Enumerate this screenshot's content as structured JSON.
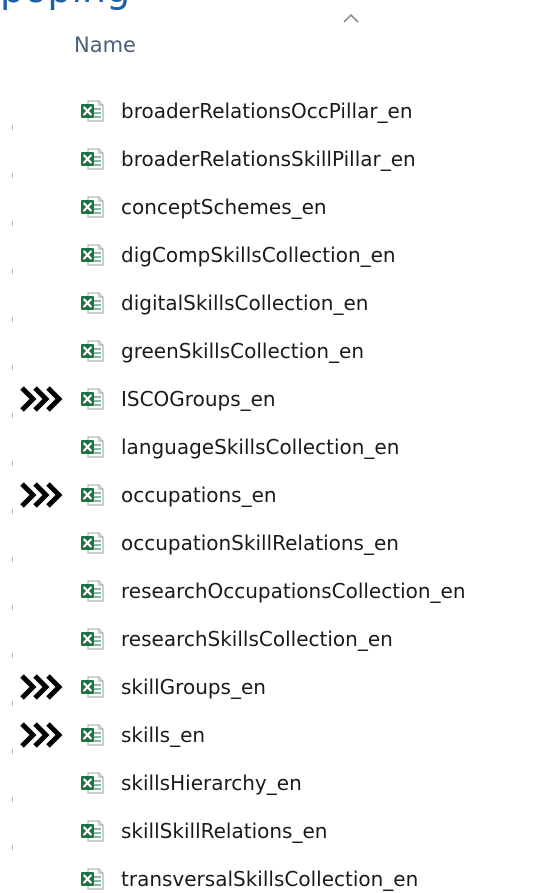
{
  "header": {
    "title_partial": "p",
    "title_fragment": "oping",
    "column_name": "Name",
    "sort_indicator": "ascending"
  },
  "files": [
    {
      "name": "broaderRelationsOccPillar_en",
      "icon": "excel-icon",
      "marked": false
    },
    {
      "name": "broaderRelationsSkillPillar_en",
      "icon": "excel-icon",
      "marked": false
    },
    {
      "name": "conceptSchemes_en",
      "icon": "excel-icon",
      "marked": false
    },
    {
      "name": "digCompSkillsCollection_en",
      "icon": "excel-icon",
      "marked": false
    },
    {
      "name": "digitalSkillsCollection_en",
      "icon": "excel-icon",
      "marked": false
    },
    {
      "name": "greenSkillsCollection_en",
      "icon": "excel-icon",
      "marked": false
    },
    {
      "name": "ISCOGroups_en",
      "icon": "excel-icon",
      "marked": true
    },
    {
      "name": "languageSkillsCollection_en",
      "icon": "excel-icon",
      "marked": false
    },
    {
      "name": "occupations_en",
      "icon": "excel-icon",
      "marked": true
    },
    {
      "name": "occupationSkillRelations_en",
      "icon": "excel-icon",
      "marked": false
    },
    {
      "name": "researchOccupationsCollection_en",
      "icon": "excel-icon",
      "marked": false
    },
    {
      "name": "researchSkillsCollection_en",
      "icon": "excel-icon",
      "marked": false
    },
    {
      "name": "skillGroups_en",
      "icon": "excel-icon",
      "marked": true
    },
    {
      "name": "skills_en",
      "icon": "excel-icon",
      "marked": true
    },
    {
      "name": "skillsHierarchy_en",
      "icon": "excel-icon",
      "marked": false
    },
    {
      "name": "skillSkillRelations_en",
      "icon": "excel-icon",
      "marked": false
    },
    {
      "name": "transversalSkillsCollection_en",
      "icon": "excel-icon",
      "marked": false
    }
  ],
  "colors": {
    "title": "#1f5fa8",
    "header_text": "#4c607a",
    "excel_green": "#1e7145",
    "marker": "#000000"
  }
}
